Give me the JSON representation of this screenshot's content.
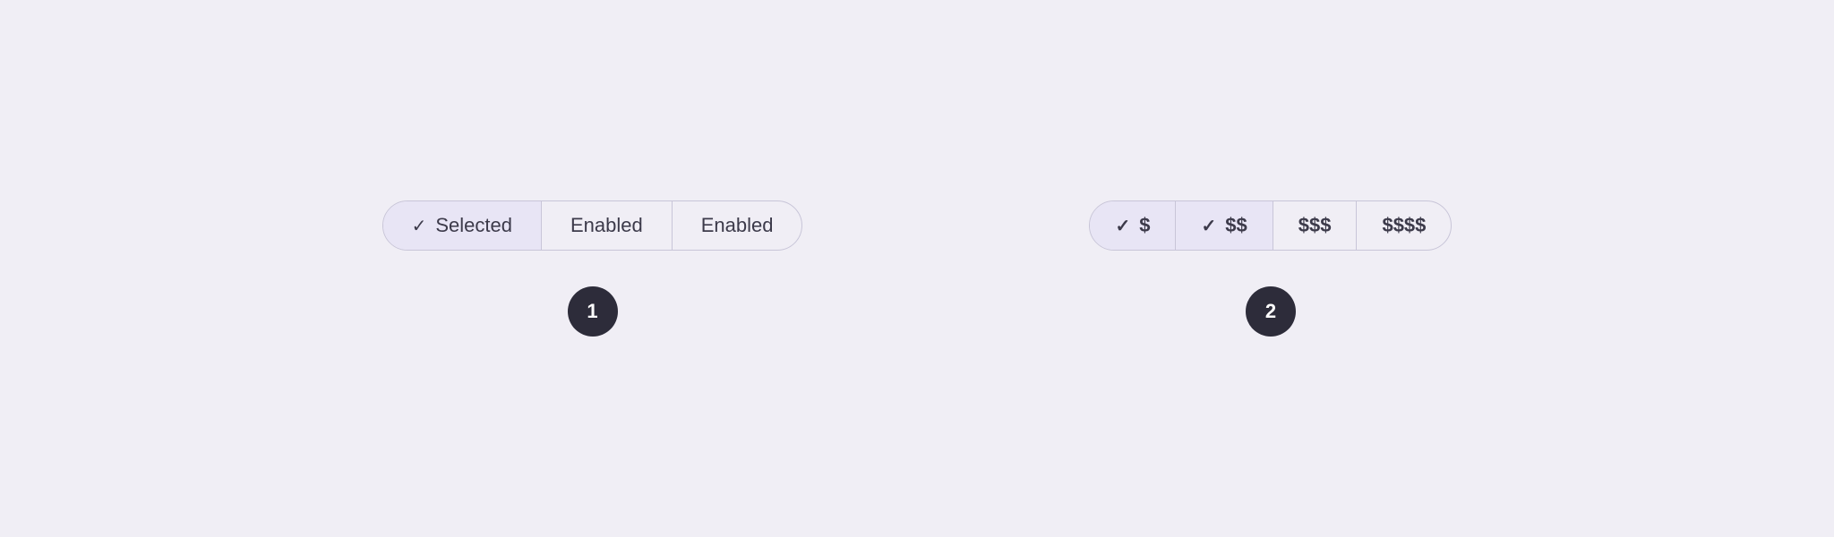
{
  "example1": {
    "segments": [
      {
        "id": "selected",
        "label": "Selected",
        "hasCheck": true,
        "state": "selected"
      },
      {
        "id": "enabled1",
        "label": "Enabled",
        "hasCheck": false,
        "state": "enabled"
      },
      {
        "id": "enabled2",
        "label": "Enabled",
        "hasCheck": false,
        "state": "enabled"
      }
    ],
    "badge": "1"
  },
  "example2": {
    "segments": [
      {
        "id": "price1",
        "label": "$",
        "hasCheck": true,
        "state": "selected"
      },
      {
        "id": "price2",
        "label": "$$",
        "hasCheck": true,
        "state": "selected-2"
      },
      {
        "id": "price3",
        "label": "$$$",
        "hasCheck": false,
        "state": "enabled"
      },
      {
        "id": "price4",
        "label": "$$$$",
        "hasCheck": false,
        "state": "enabled"
      }
    ],
    "badge": "2"
  },
  "checkmark_char": "✓"
}
